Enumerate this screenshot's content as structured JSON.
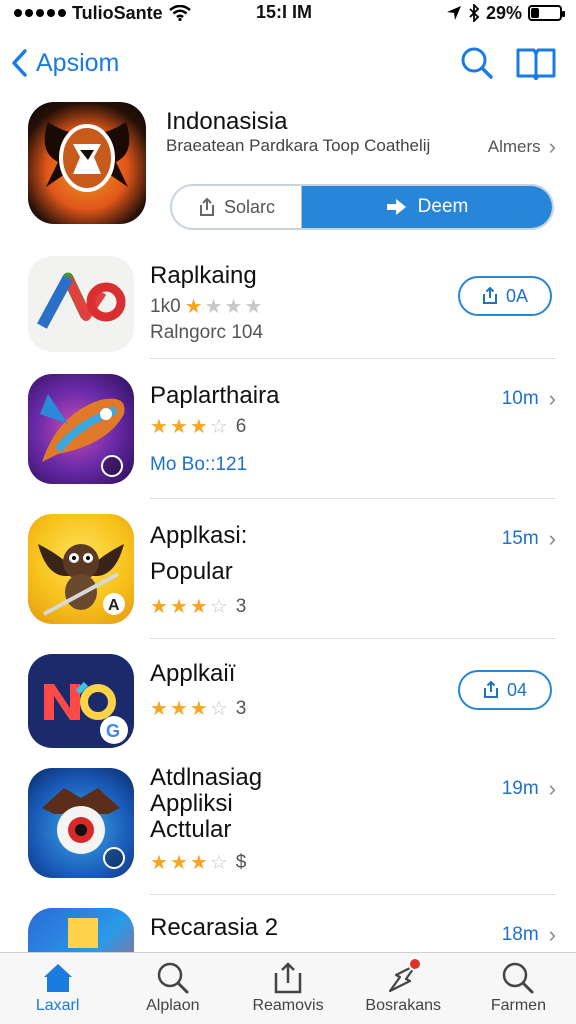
{
  "status_bar": {
    "carrier": "TulioSante",
    "time": "15:I IM",
    "battery_percent": "29%",
    "battery_level": 0.29
  },
  "nav": {
    "back_label": "Apsiom"
  },
  "featured": {
    "title": "Indonasisia",
    "subtitle": "Braeatean Pardkara Toop Coathelij",
    "more_label": "Almers",
    "seg_left_label": "Solarc",
    "seg_right_label": "Deem"
  },
  "apps": [
    {
      "name": "Raplkaing",
      "stars": 1,
      "rating_text": "1k0",
      "meta": "Ralngorc 104",
      "action_label": "0A"
    },
    {
      "name": "Paplarthaira",
      "stars": 3,
      "rating_text": "6",
      "meta": "Mo Bo::121",
      "action_label": "10m"
    },
    {
      "name_line1": "Applkasi:",
      "name_line2": "Popular",
      "stars": 3,
      "rating_text": "3",
      "action_label": "15m"
    },
    {
      "name": "Applkaiï",
      "stars": 3,
      "rating_text": "3",
      "action_label": "04"
    },
    {
      "name_line1": "Atdlnasiag",
      "name_line2": "Appliksi",
      "name_line3": "Acttular",
      "stars": 3,
      "rating_text": "$",
      "action_label": "19m"
    },
    {
      "name": "Recarasia 2",
      "action_label": "18m"
    }
  ],
  "tabs": [
    {
      "label": "Laxarl",
      "icon": "home-icon",
      "active": true
    },
    {
      "label": "Alplaon",
      "icon": "search-icon"
    },
    {
      "label": "Reamovis",
      "icon": "share-icon"
    },
    {
      "label": "Bosrakans",
      "icon": "bolt-icon",
      "badge": true
    },
    {
      "label": "Farmen",
      "icon": "search-icon"
    }
  ],
  "colors": {
    "accent": "#1a7be0",
    "star": "#f5a623",
    "badge": "#e0302a"
  }
}
